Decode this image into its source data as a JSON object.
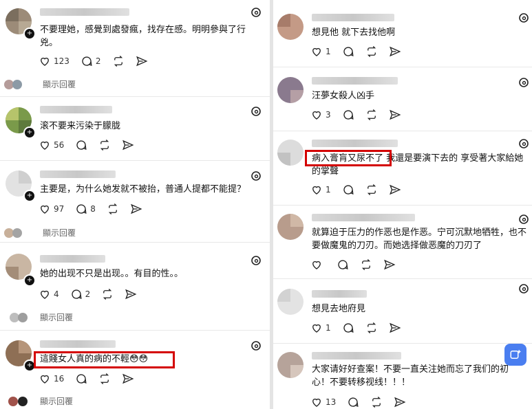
{
  "left_feed": {
    "posts": [
      {
        "text": "不要理她，感覺到處發瘋，找存在感。明明參與了行兇。",
        "likes": "123",
        "replies": "2"
      },
      {
        "text": "滚不要来污染于朦胧",
        "likes": "56"
      },
      {
        "text": "主要是，为什么她发就不被抬，普通人提都不能提？",
        "likes": "97",
        "replies": "8"
      },
      {
        "text": "她的出现不只是出现。。有目的性。。",
        "likes": "4",
        "replies": "2"
      },
      {
        "text": "這賤女人真的病的不輕😳😳",
        "likes": "16"
      }
    ],
    "show_replies_label": "顯示回覆"
  },
  "right_feed": {
    "posts": [
      {
        "text": "想見他 就下去找他啊",
        "likes": "1"
      },
      {
        "text": "汪夢女殺人凶手",
        "likes": "3"
      },
      {
        "text": "病入膏肓又尿不了 我還是要演下去的  享受著大家給她的掌聲",
        "likes": "1"
      },
      {
        "text": "就算迫于压力的作恶也是作恶。宁可沉默地牺牲，也不要做魔鬼的刀刃。而她选择做恶魔的刀刃了",
        "likes": ""
      },
      {
        "text": "想見去地府見",
        "likes": "1"
      },
      {
        "text": "大家请好好查案！不要一直关注她而忘了我们的初心！不要转移视线！！！",
        "likes": "13"
      }
    ]
  },
  "icons": [
    "heart-icon",
    "comment-icon",
    "repost-icon",
    "share-icon",
    "threads-icon",
    "compose-icon",
    "follow-plus-icon"
  ],
  "colors": {
    "highlight": "#d40000",
    "fab": "#4a7ef0"
  }
}
